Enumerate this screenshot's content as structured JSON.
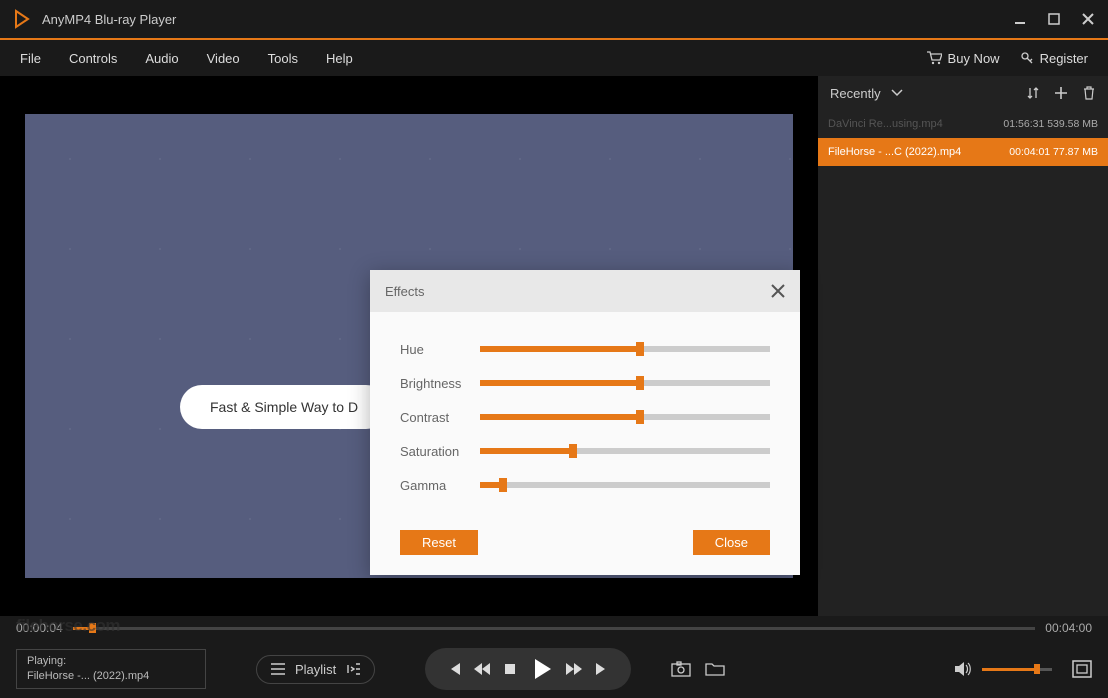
{
  "app": {
    "title": "AnyMP4 Blu-ray Player"
  },
  "titlebar": {
    "buy_now": "Buy Now",
    "register": "Register"
  },
  "menu": [
    "File",
    "Controls",
    "Audio",
    "Video",
    "Tools",
    "Help"
  ],
  "video": {
    "promo_text": "Fast & Simple Way to D"
  },
  "effects": {
    "title": "Effects",
    "rows": [
      {
        "label": "Hue",
        "value": 55
      },
      {
        "label": "Brightness",
        "value": 55
      },
      {
        "label": "Contrast",
        "value": 55
      },
      {
        "label": "Saturation",
        "value": 32
      },
      {
        "label": "Gamma",
        "value": 8
      }
    ],
    "reset": "Reset",
    "close": "Close"
  },
  "playlist": {
    "header": "Recently",
    "items": [
      {
        "name": "DaVinci Re...using.mp4",
        "duration": "01:56:31",
        "size": "539.58 MB",
        "selected": false
      },
      {
        "name": "FileHorse - ...C (2022).mp4",
        "duration": "00:04:01",
        "size": "77.87 MB",
        "selected": true
      }
    ]
  },
  "progress": {
    "current": "00:00:04",
    "total": "00:04:00",
    "percent": 2
  },
  "now_playing": {
    "label": "Playing:",
    "file": "FileHorse -... (2022).mp4"
  },
  "playlist_button": "Playlist",
  "volume": {
    "percent": 78
  },
  "colors": {
    "accent": "#e67817"
  },
  "watermark": "filehorse.com"
}
